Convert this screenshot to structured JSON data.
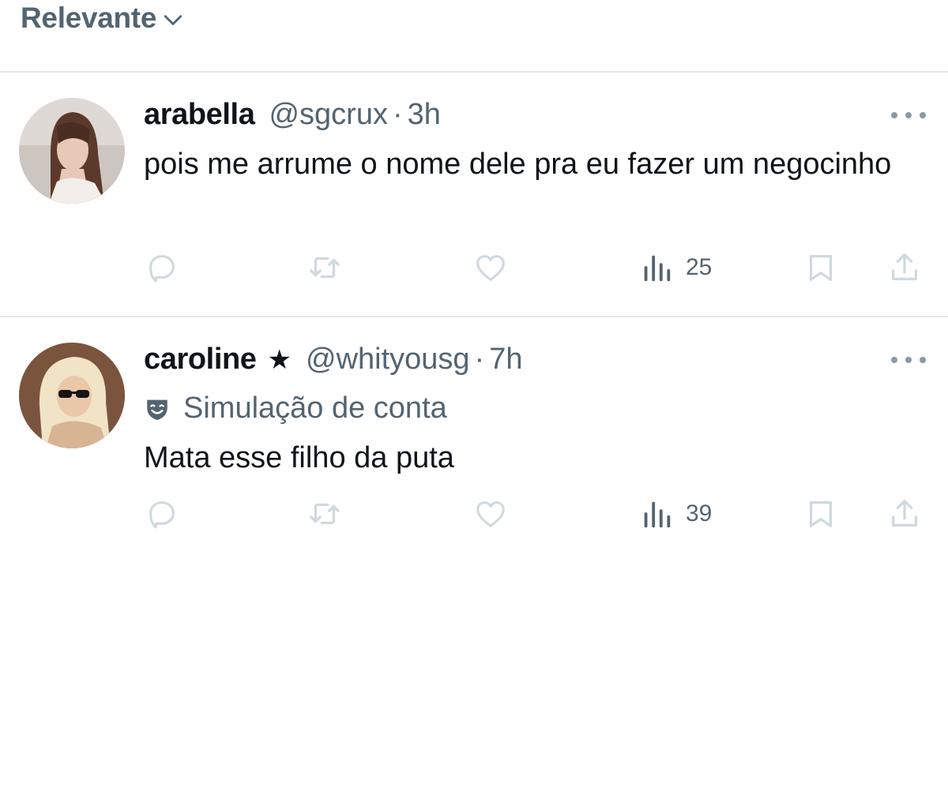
{
  "sort": {
    "label": "Relevante",
    "icon": "chevron-down-icon"
  },
  "colors": {
    "text": "#0f1419",
    "secondary": "#536471",
    "icon": "#cfd9de",
    "divider": "#e7e9ea"
  },
  "tweets": [
    {
      "name": "arabella",
      "badge": "",
      "handle": "@sgcrux",
      "separator": "·",
      "time": "3h",
      "account_label": "",
      "text": "pois me arrume o nome dele pra eu fazer um negocinho",
      "views": "25"
    },
    {
      "name": "caroline",
      "badge": "★",
      "handle": "@whityousg",
      "separator": "·",
      "time": "7h",
      "account_label": "Simulação de conta",
      "text": "Mata esse filho da puta",
      "views": "39"
    }
  ]
}
